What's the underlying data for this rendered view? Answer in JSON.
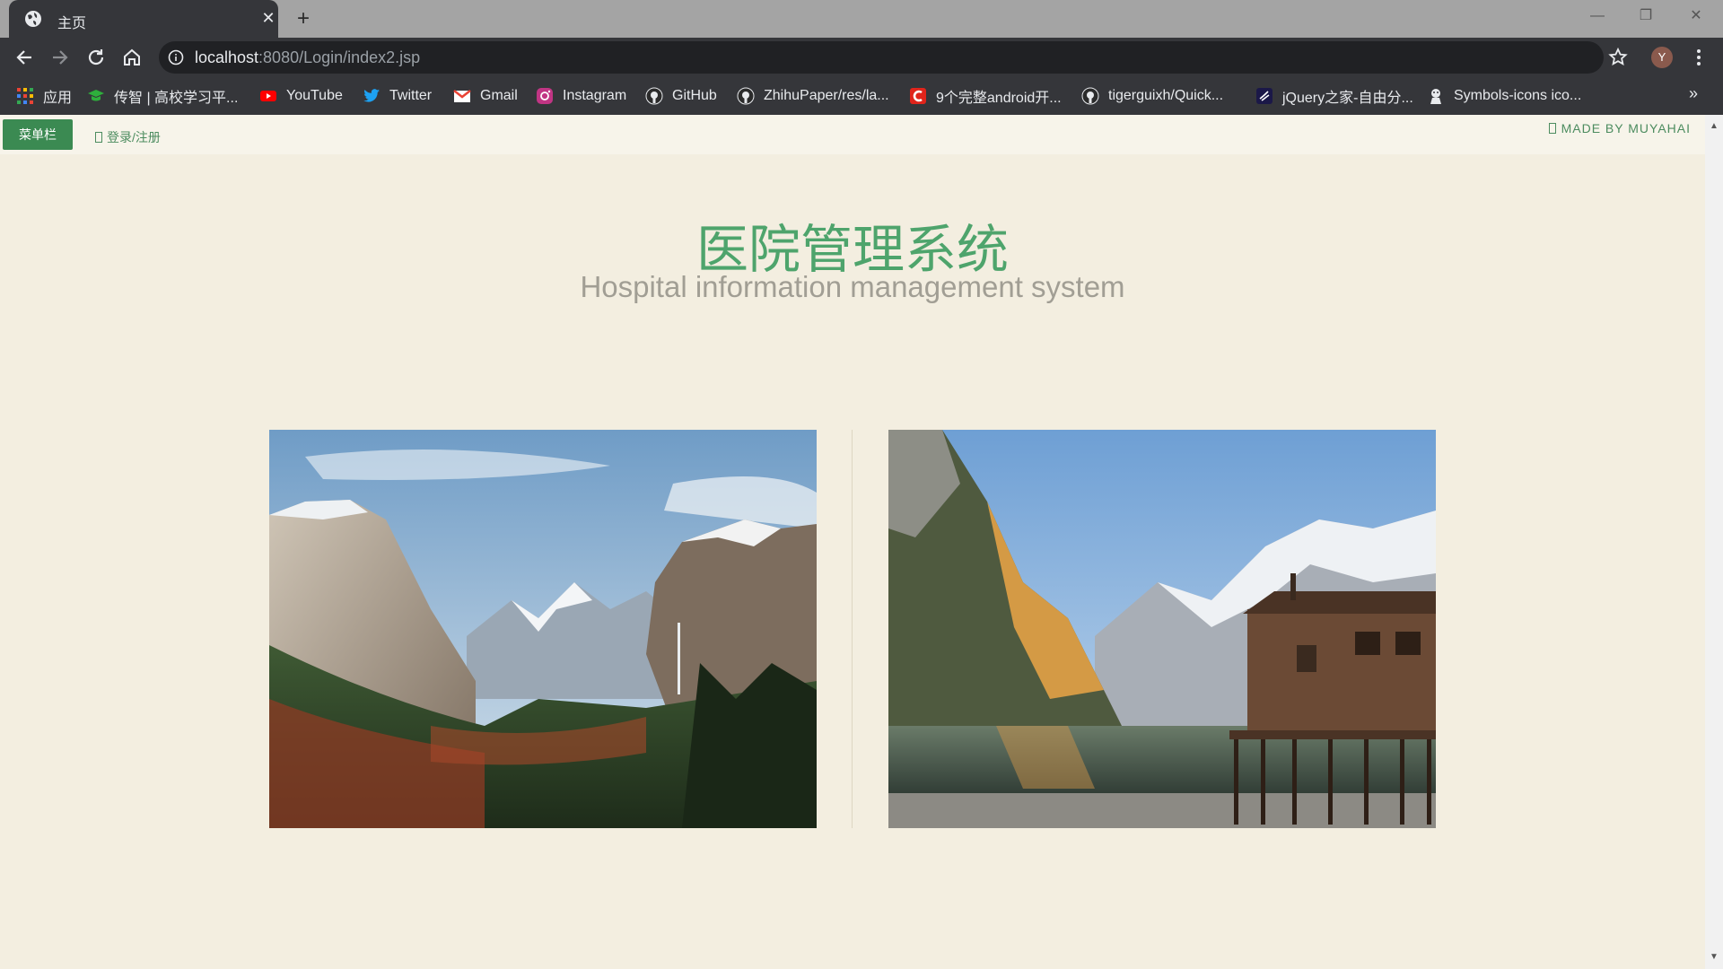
{
  "browser": {
    "tab_title": "主页",
    "url_host": "localhost",
    "url_rest": ":8080/Login/index2.jsp",
    "avatar_letter": "Y",
    "bookmarks": [
      {
        "label": "应用",
        "icon": "apps-grid-icon"
      },
      {
        "label": "传智 | 高校学习平...",
        "icon": "graduation-cap-icon"
      },
      {
        "label": "YouTube",
        "icon": "youtube-icon"
      },
      {
        "label": "Twitter",
        "icon": "twitter-icon"
      },
      {
        "label": "Gmail",
        "icon": "gmail-icon"
      },
      {
        "label": "Instagram",
        "icon": "instagram-icon"
      },
      {
        "label": "GitHub",
        "icon": "github-icon"
      },
      {
        "label": "ZhihuPaper/res/la...",
        "icon": "github-icon"
      },
      {
        "label": "9个完整android开...",
        "icon": "csdn-icon"
      },
      {
        "label": "tigerguixh/Quick...",
        "icon": "github-icon"
      },
      {
        "label": "jQuery之家-自由分...",
        "icon": "jquery-icon"
      },
      {
        "label": "Symbols-icons ico...",
        "icon": "symbols-icon"
      }
    ],
    "more_label": "»"
  },
  "page": {
    "menu_button": "菜单栏",
    "login_link": "登录/注册",
    "made_by": "MADE BY MUYAHAI",
    "title": "医院管理系统",
    "subtitle": "Hospital information management system"
  },
  "colors": {
    "accent_green": "#3b8a52",
    "title_green": "#4ea46c",
    "page_bg": "#f3eee0"
  }
}
